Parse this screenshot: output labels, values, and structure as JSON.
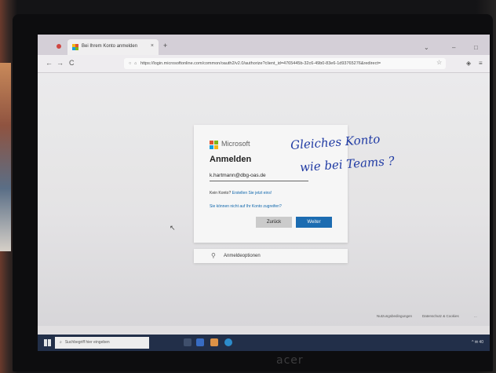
{
  "browser": {
    "tab_title": "Bei Ihrem Konto anmelden",
    "tab_close": "×",
    "new_tab": "+",
    "back": "←",
    "forward": "→",
    "reload": "C",
    "url": "https://login.microsoftonline.com/common/oauth2/v2.0/authorize?client_id=4765445b-32c6-49b0-83e6-1d93765276&redirect=",
    "bookmark_star": "☆"
  },
  "signin": {
    "brand": "Microsoft",
    "heading": "Anmelden",
    "email_value": "k.hartmann@dbg-oas.de",
    "no_account_text": "Kein Konto? ",
    "create_link": "Erstellen Sie jetzt eins!",
    "cant_access": "Sie können nicht auf Ihr Konto zugreifen?",
    "back_button": "Zurück",
    "next_button": "Weiter"
  },
  "signin_options": {
    "label": "Anmeldeoptionen"
  },
  "footer": {
    "terms": "Nutzungsbedingungen",
    "privacy": "Datenschutz & Cookies",
    "more": "..."
  },
  "handwriting": {
    "line1": "Gleiches Konto",
    "line2": "wie bei Teams ?"
  },
  "taskbar": {
    "search_placeholder": "Suchbegriff hier eingeben",
    "tray": "^ ✉ 40"
  },
  "hardware": {
    "brand": "acer"
  },
  "colors": {
    "ms_red": "#f25022",
    "ms_green": "#7fba00",
    "ms_blue": "#00a4ef",
    "ms_yellow": "#ffb900",
    "accent": "#0f6cbd",
    "ink": "#1f3aa3"
  }
}
